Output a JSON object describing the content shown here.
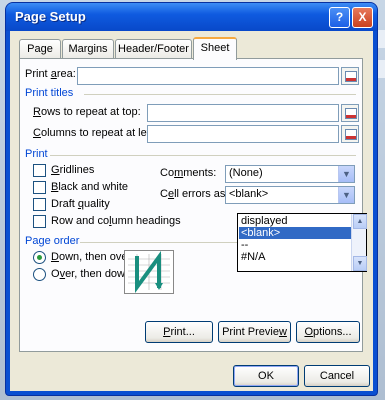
{
  "window": {
    "title": "Page Setup",
    "help_label": "?",
    "close_label": "X"
  },
  "tabs": [
    "Page",
    "Margins",
    "Header/Footer",
    "Sheet"
  ],
  "active_tab": "Sheet",
  "print_area": {
    "label_pre": "Print ",
    "label_u": "a",
    "label_post": "rea:",
    "value": ""
  },
  "print_titles": {
    "heading": "Print titles",
    "rows": {
      "label_u": "R",
      "label_post": "ows to repeat at top:",
      "value": ""
    },
    "cols": {
      "label_u": "C",
      "label_post": "olumns to repeat at left:",
      "value": ""
    }
  },
  "print": {
    "heading": "Print",
    "checkboxes": [
      {
        "u": "G",
        "rest": "ridlines",
        "checked": false
      },
      {
        "u": "B",
        "rest": "lack and white",
        "checked": false
      },
      {
        "u": "",
        "pre": "Draft ",
        "u2": "q",
        "rest": "uality",
        "checked": false
      },
      {
        "u": "",
        "pre": "Row and co",
        "u2": "l",
        "rest": "umn headings",
        "checked": false
      }
    ],
    "comments": {
      "label_pre": "Co",
      "label_u": "m",
      "label_post": "ments:",
      "value": "(None)"
    },
    "cell_errors": {
      "label_pre": "C",
      "label_u": "e",
      "label_post": "ll errors as:",
      "value": "<blank>"
    },
    "cell_error_options": [
      "displayed",
      "<blank>",
      "--",
      "#N/A"
    ],
    "cell_error_selected": "<blank>"
  },
  "page_order": {
    "heading": "Page order",
    "down_then_over": {
      "u": "D",
      "rest": "own, then over",
      "selected": true
    },
    "over_then_down": {
      "pre": "O",
      "u": "v",
      "rest": "er, then down",
      "selected": false
    }
  },
  "buttons": {
    "print": {
      "u": "P",
      "rest": "rint..."
    },
    "print_preview": {
      "pre": "Print Previe",
      "u": "w",
      "rest": ""
    },
    "options": {
      "u": "O",
      "rest": "ptions..."
    },
    "ok": "OK",
    "cancel": "Cancel"
  },
  "colors": {
    "title_bar": "#0f5be0",
    "section_heading": "#0046d5",
    "selection": "#316ac5"
  }
}
